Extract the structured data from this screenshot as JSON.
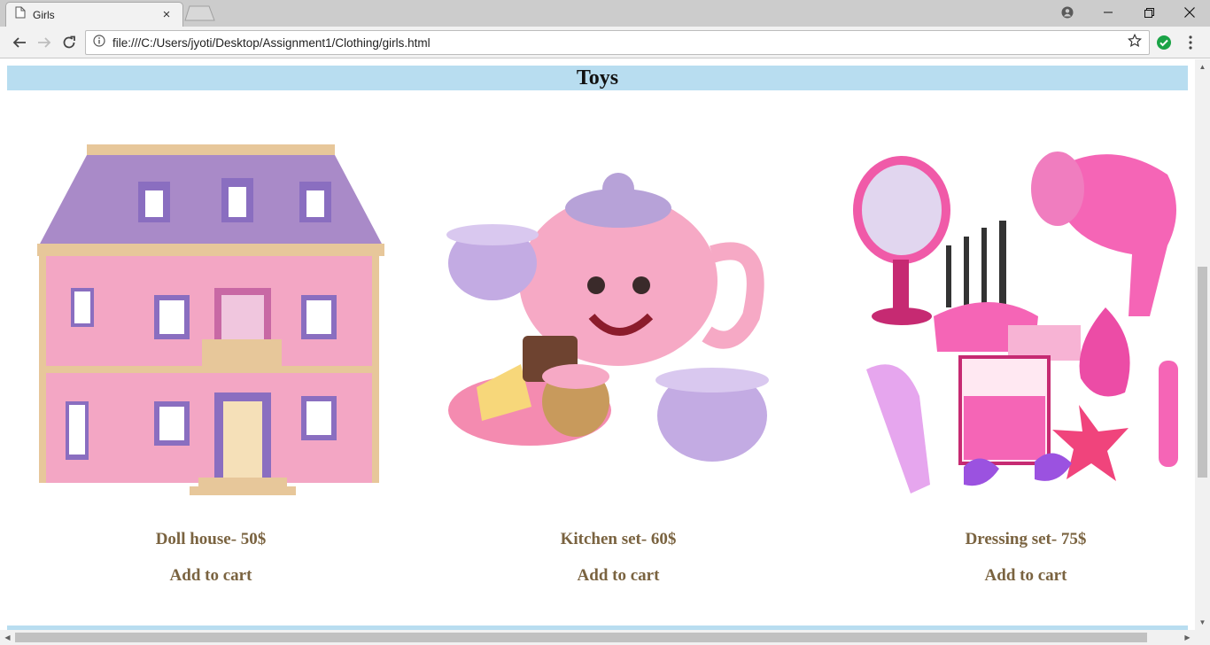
{
  "browser": {
    "tab_title": "Girls",
    "tab_close": "×",
    "url": "file:///C:/Users/jyoti/Desktop/Assignment1/Clothing/girls.html"
  },
  "icons": {
    "page": "page-icon",
    "close": "close-icon",
    "back": "back-arrow-icon",
    "forward": "forward-arrow-icon",
    "reload": "reload-icon",
    "info": "info-icon",
    "star": "star-icon",
    "extension": "check-circle-icon",
    "menu": "kebab-menu-icon",
    "profile": "account-icon"
  },
  "colors": {
    "header_band": "#b8ddf0",
    "product_text": "#7a6340",
    "extension_green": "#1aa346"
  },
  "page": {
    "section_title": "Toys",
    "products": [
      {
        "name": "Doll house- 50$",
        "action": "Add to cart"
      },
      {
        "name": "Kitchen set- 60$",
        "action": "Add to cart"
      },
      {
        "name": "Dressing set- 75$",
        "action": "Add to cart"
      }
    ]
  }
}
